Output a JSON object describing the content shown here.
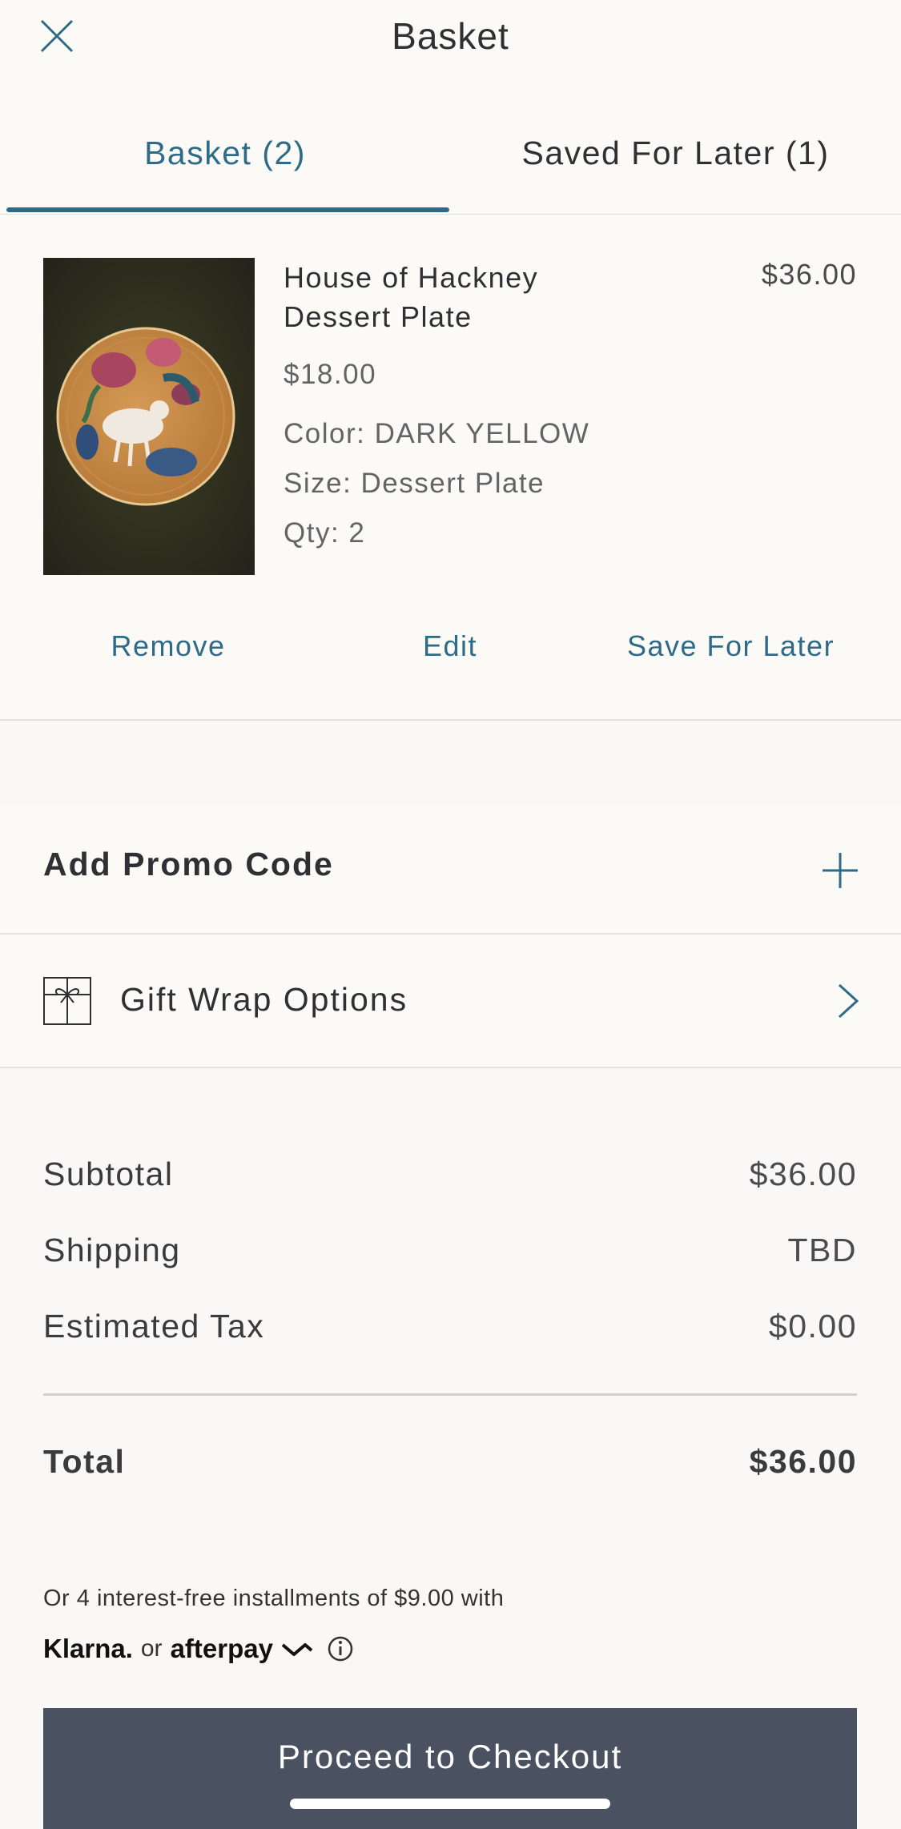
{
  "header": {
    "title": "Basket"
  },
  "tabs": [
    {
      "label": "Basket (2)",
      "active": true
    },
    {
      "label": "Saved For Later (1)",
      "active": false
    }
  ],
  "item": {
    "name": "House of Hackney Dessert Plate",
    "line_total": "$36.00",
    "price": "$18.00",
    "color": "Color: DARK YELLOW",
    "size": "Size: Dessert Plate",
    "qty": "Qty: 2",
    "actions": {
      "remove": "Remove",
      "edit": "Edit",
      "save": "Save For Later"
    }
  },
  "promo": {
    "label": "Add Promo Code"
  },
  "gift": {
    "label": "Gift Wrap Options"
  },
  "summary": {
    "subtotal_label": "Subtotal",
    "subtotal": "$36.00",
    "shipping_label": "Shipping",
    "shipping": "TBD",
    "tax_label": "Estimated Tax",
    "tax": "$0.00",
    "total_label": "Total",
    "total": "$36.00"
  },
  "installments": {
    "text": "Or 4 interest-free installments of $9.00 with",
    "klarna": "Klarna.",
    "or": "or",
    "afterpay": "afterpay"
  },
  "checkout": {
    "label": "Proceed to Checkout"
  },
  "colors": {
    "accent": "#2e6b88",
    "checkout_bg": "#4a5261",
    "background": "#f9f8f6"
  }
}
